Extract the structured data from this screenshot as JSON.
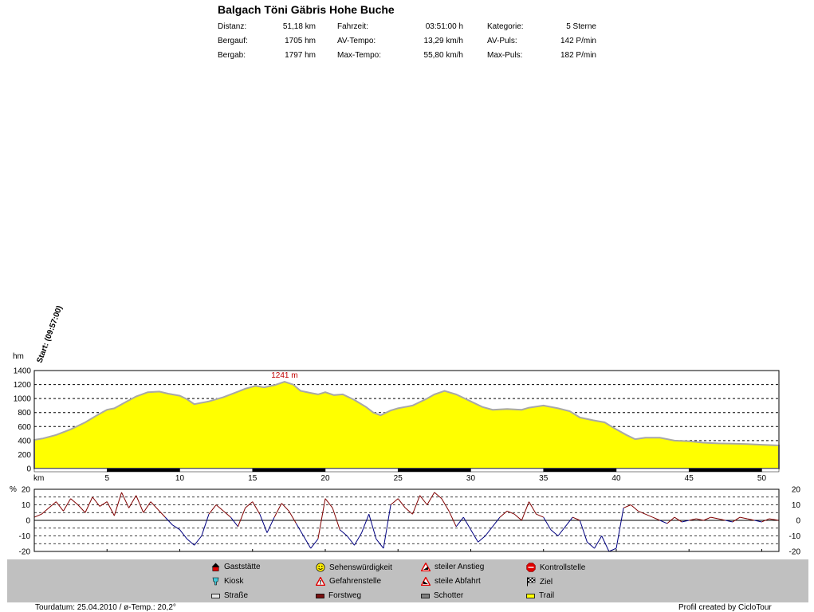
{
  "title": "Balgach Töni Gäbris Hohe Buche",
  "stats": [
    {
      "label": "Distanz:",
      "value": "51,18 km"
    },
    {
      "label": "Bergauf:",
      "value": "1705 hm"
    },
    {
      "label": "Bergab:",
      "value": "1797 hm"
    },
    {
      "label": "Fahrzeit:",
      "value": "03:51:00 h"
    },
    {
      "label": "AV-Tempo:",
      "value": "13,29 km/h"
    },
    {
      "label": "Max-Tempo:",
      "value": "55,80 km/h"
    },
    {
      "label": "Kategorie:",
      "value": "5 Sterne"
    },
    {
      "label": "AV-Puls:",
      "value": "142 P/min"
    },
    {
      "label": "Max-Puls:",
      "value": "182 P/min"
    }
  ],
  "start_label": "Start: (09:57:00)",
  "colors": {
    "fill": "#ffff00",
    "outline": "#a8a8a8",
    "climb": "#800000",
    "descent": "#000080",
    "legend_bg": "#c0c0c0"
  },
  "legend": [
    {
      "icon": "gaststaette-icon",
      "label": "Gaststätte"
    },
    {
      "icon": "kiosk-icon",
      "label": "Kiosk"
    },
    {
      "icon": "strasse-icon",
      "label": "Straße"
    },
    {
      "icon": "sehenswuerdigkeit-icon",
      "label": "Sehenswürdigkeit"
    },
    {
      "icon": "gefahrenstelle-icon",
      "label": "Gefahrenstelle"
    },
    {
      "icon": "forstweg-icon",
      "label": "Forstweg"
    },
    {
      "icon": "steiler-anstieg-icon",
      "label": "steiler Anstieg"
    },
    {
      "icon": "steile-abfahrt-icon",
      "label": "steile Abfahrt"
    },
    {
      "icon": "schotter-icon",
      "label": "Schotter"
    },
    {
      "icon": "kontrollstelle-icon",
      "label": "Kontrollstelle"
    },
    {
      "icon": "ziel-icon",
      "label": "Ziel"
    },
    {
      "icon": "trail-icon",
      "label": "Trail"
    }
  ],
  "footer": {
    "left": "Tourdatum: 25.04.2010  /  ø-Temp.: 20,2°",
    "right": "Profil created by CicloTour"
  },
  "chart_data": [
    {
      "type": "area",
      "ylabel": "hm",
      "xlabel": "km",
      "xlim": [
        0,
        51.18
      ],
      "ylim": [
        0,
        1400
      ],
      "yticks": [
        0,
        200,
        400,
        600,
        800,
        1000,
        1200,
        1400
      ],
      "xticks": [
        5,
        10,
        15,
        20,
        25,
        30,
        35,
        40,
        45,
        50
      ],
      "annotation": {
        "x": 17.2,
        "y": 1241,
        "label": "1241 m"
      },
      "series": [
        {
          "x": [
            0,
            0.6,
            1.5,
            2.5,
            3.5,
            4.3,
            5.0,
            5.5,
            6.2,
            7.0,
            7.8,
            8.6,
            9.2,
            10.0,
            10.5,
            11.0,
            12.0,
            13.0,
            14.0,
            14.5,
            15.2,
            15.8,
            16.5,
            17.2,
            17.8,
            18.3,
            19.0,
            19.5,
            20.0,
            20.6,
            21.2,
            22.0,
            22.8,
            23.3,
            23.8,
            24.5,
            25.0,
            26.0,
            27.0,
            27.5,
            28.2,
            29.0,
            30.0,
            30.8,
            31.5,
            32.5,
            33.5,
            34.0,
            35.0,
            36.0,
            36.8,
            37.5,
            38.4,
            39.2,
            40.0,
            40.7,
            41.3,
            42.0,
            43.0,
            44.0,
            45.0,
            46.0,
            47.0,
            48.0,
            49.0,
            50.0,
            51.18
          ],
          "y": [
            410,
            430,
            480,
            560,
            660,
            760,
            840,
            860,
            940,
            1030,
            1090,
            1100,
            1070,
            1040,
            990,
            920,
            960,
            1020,
            1100,
            1140,
            1180,
            1160,
            1190,
            1241,
            1200,
            1110,
            1080,
            1060,
            1090,
            1050,
            1060,
            980,
            880,
            800,
            760,
            830,
            860,
            900,
            1000,
            1060,
            1110,
            1060,
            960,
            880,
            840,
            850,
            840,
            870,
            900,
            860,
            820,
            730,
            690,
            660,
            560,
            480,
            420,
            440,
            440,
            400,
            390,
            370,
            360,
            355,
            350,
            340,
            330
          ]
        }
      ]
    },
    {
      "type": "line",
      "ylabel": "%",
      "xlim": [
        0,
        51.18
      ],
      "ylim": [
        -20,
        20
      ],
      "yticks": [
        -20,
        -10,
        0,
        10,
        20
      ],
      "series": [
        {
          "x": [
            0,
            0.5,
            1.0,
            1.5,
            2.0,
            2.5,
            3.0,
            3.5,
            4.0,
            4.5,
            5.0,
            5.5,
            6.0,
            6.5,
            7.0,
            7.5,
            8.0,
            8.5,
            9.0,
            9.5,
            10.0,
            10.5,
            11.0,
            11.5,
            12.0,
            12.5,
            13.0,
            13.5,
            14.0,
            14.5,
            15.0,
            15.5,
            16.0,
            16.5,
            17.0,
            17.5,
            18.0,
            18.5,
            19.0,
            19.5,
            20.0,
            20.5,
            21.0,
            21.5,
            22.0,
            22.5,
            23.0,
            23.5,
            24.0,
            24.5,
            25.0,
            25.5,
            26.0,
            26.5,
            27.0,
            27.5,
            28.0,
            28.5,
            29.0,
            29.5,
            30.0,
            30.5,
            31.0,
            31.5,
            32.0,
            32.5,
            33.0,
            33.5,
            34.0,
            34.5,
            35.0,
            35.5,
            36.0,
            36.5,
            37.0,
            37.5,
            38.0,
            38.5,
            39.0,
            39.5,
            40.0,
            40.5,
            41.0,
            41.5,
            42.0,
            42.5,
            43.0,
            43.5,
            44.0,
            44.5,
            45.0,
            45.5,
            46.0,
            46.5,
            47.0,
            47.5,
            48.0,
            48.5,
            49.0,
            49.5,
            50.0,
            50.5,
            51.18
          ],
          "y": [
            2,
            4,
            8,
            12,
            6,
            14,
            10,
            5,
            15,
            9,
            12,
            3,
            18,
            8,
            16,
            5,
            12,
            7,
            2,
            -3,
            -6,
            -12,
            -16,
            -10,
            4,
            10,
            6,
            2,
            -4,
            8,
            12,
            4,
            -8,
            2,
            11,
            6,
            -2,
            -10,
            -18,
            -12,
            14,
            8,
            -6,
            -10,
            -16,
            -8,
            4,
            -12,
            -18,
            10,
            14,
            8,
            4,
            16,
            10,
            18,
            14,
            6,
            -4,
            2,
            -6,
            -14,
            -10,
            -4,
            2,
            6,
            4,
            0,
            12,
            4,
            2,
            -6,
            -10,
            -4,
            2,
            0,
            -14,
            -18,
            -10,
            -20,
            -18,
            8,
            10,
            6,
            4,
            2,
            0,
            -2,
            2,
            -1,
            0,
            1,
            0,
            2,
            1,
            0,
            -1,
            2,
            1,
            0,
            -1,
            1,
            0
          ]
        }
      ]
    }
  ]
}
